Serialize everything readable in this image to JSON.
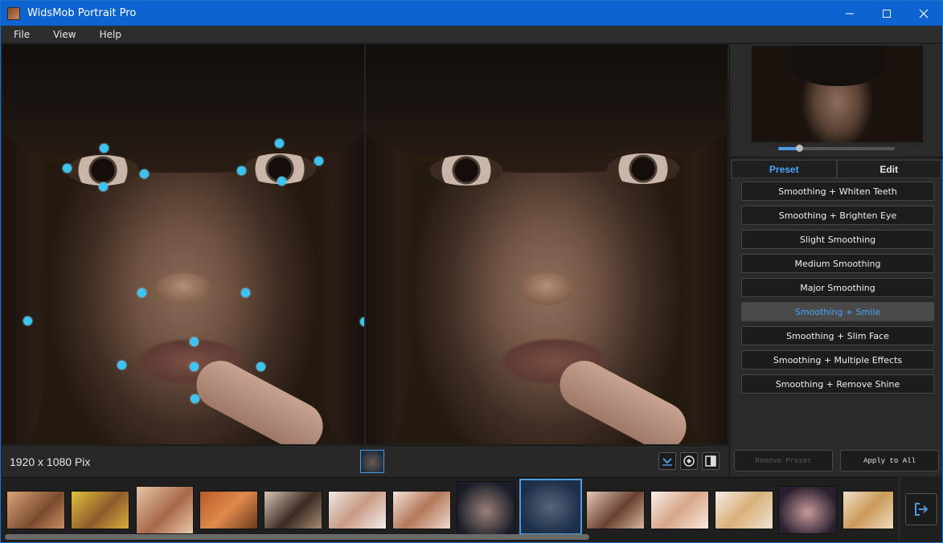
{
  "window": {
    "title": "WidsMob Portrait Pro"
  },
  "menu": {
    "items": [
      "File",
      "View",
      "Help"
    ]
  },
  "tabs": {
    "preset": "Preset",
    "edit": "Edit"
  },
  "presets": [
    "Smoothing + Whiten Teeth",
    "Smoothing + Brighten Eye",
    "Slight Smoothing",
    "Medium Smoothing",
    "Major Smoothing",
    "Smoothing + Smile",
    "Smoothing + Slim Face",
    "Smoothing + Multiple Effects",
    "Smoothing + Remove Shine"
  ],
  "selected_preset": "Smoothing + Smile",
  "buttons": {
    "remove_preset": "Remove Preset",
    "apply_to_all": "Apply to All"
  },
  "status": {
    "resolution": "1920 x 1080 Pix"
  },
  "zoom": {
    "level": 0.18
  },
  "filmstrip": {
    "count": 14,
    "selected_index": 8
  },
  "colors": {
    "accent": "#4a9be2",
    "titlebar": "#0d63cf",
    "landmark": "#3cc3ef"
  },
  "icons": {
    "app": "app-icon",
    "minimize": "minimize-icon",
    "maximize": "maximize-icon",
    "close": "close-icon",
    "download": "download-icon",
    "compare": "compare-icon",
    "split_view": "split-view-icon",
    "export": "export-icon"
  }
}
